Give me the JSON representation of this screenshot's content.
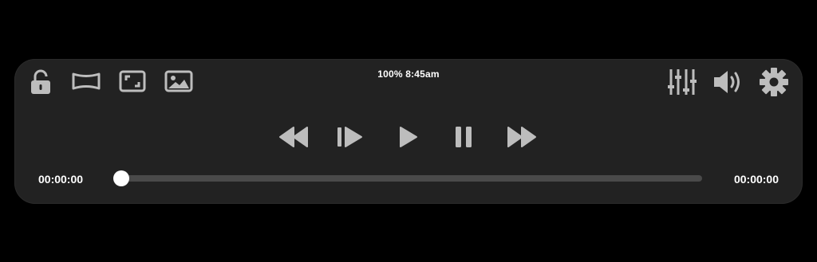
{
  "status": {
    "text": "100% 8:45am"
  },
  "time": {
    "elapsed": "00:00:00",
    "total": "00:00:00"
  },
  "progress": {
    "fraction": 0
  },
  "colors": {
    "panel": "#222222",
    "icon": "#bdbdbd",
    "text": "#ffffff",
    "track": "#4a4a4a",
    "thumb": "#ffffff"
  },
  "left_icons": [
    "lock-icon",
    "aspect-ratio-icon",
    "fullscreen-icon",
    "image-icon"
  ],
  "center_controls": [
    "rewind-icon",
    "step-forward-icon",
    "play-icon",
    "pause-icon",
    "fast-forward-icon"
  ],
  "right_icons": [
    "equalizer-icon",
    "volume-icon",
    "settings-gear-icon"
  ]
}
